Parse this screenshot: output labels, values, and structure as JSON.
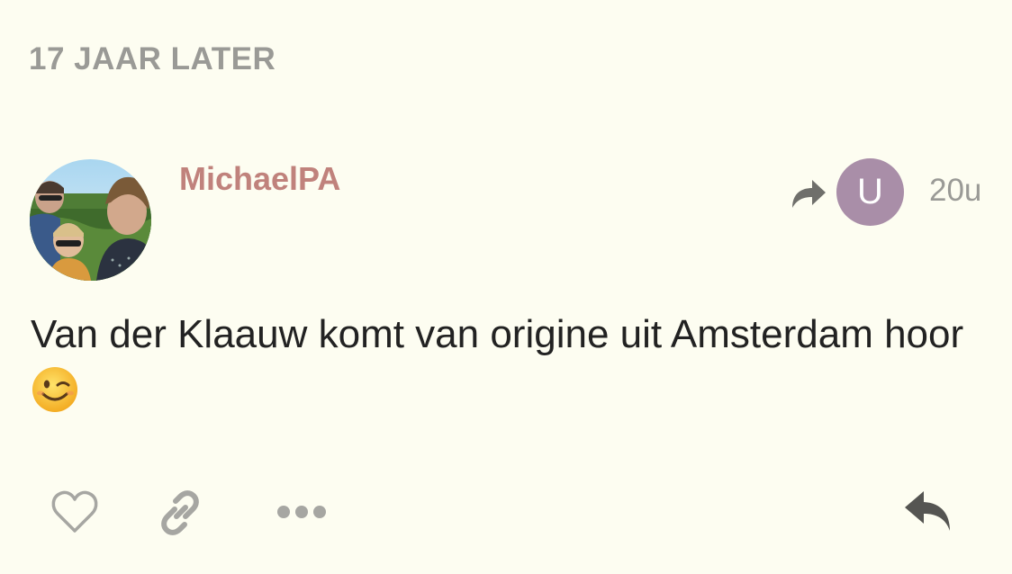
{
  "section": {
    "label": "17 JAAR LATER"
  },
  "post": {
    "username": "MichaelPA",
    "reply_to_avatar_letter": "U",
    "timestamp": "20u",
    "body": "Van der Klaauw komt van origine uit Amsterdam hoor",
    "emoji": "winking-face-emoji"
  },
  "icons": {
    "share": "share-arrow-icon",
    "like": "heart-icon",
    "link": "link-icon",
    "more": "more-dots-icon",
    "reply": "reply-icon"
  },
  "colors": {
    "background": "#fdfdf1",
    "username": "#c0827c",
    "muted_text": "#9a9a96",
    "reply_avatar": "#a98ea8",
    "body_text": "#222222"
  }
}
